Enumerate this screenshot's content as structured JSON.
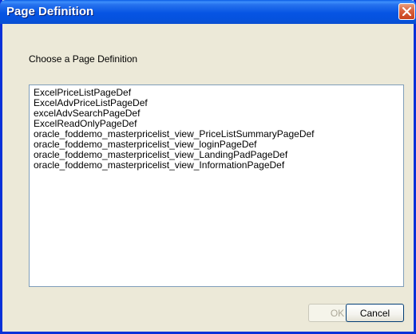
{
  "window": {
    "title": "Page Definition"
  },
  "prompt": "Choose a Page Definition",
  "list": {
    "items": [
      "ExcelPriceListPageDef",
      "ExcelAdvPriceListPageDef",
      "excelAdvSearchPageDef",
      "ExcelReadOnlyPageDef",
      "oracle_foddemo_masterpricelist_view_PriceListSummaryPageDef",
      "oracle_foddemo_masterpricelist_view_loginPageDef",
      "oracle_foddemo_masterpricelist_view_LandingPadPageDef",
      "oracle_foddemo_masterpricelist_view_InformationPageDef"
    ]
  },
  "buttons": {
    "ok_label": "OK",
    "ok_enabled": false,
    "cancel_label": "Cancel"
  },
  "icons": {
    "close": "close-icon"
  },
  "colors": {
    "titlebar": "#0654e3",
    "dialog_bg": "#ece9d8",
    "close_button": "#d9613d",
    "list_border": "#7f9db9"
  }
}
